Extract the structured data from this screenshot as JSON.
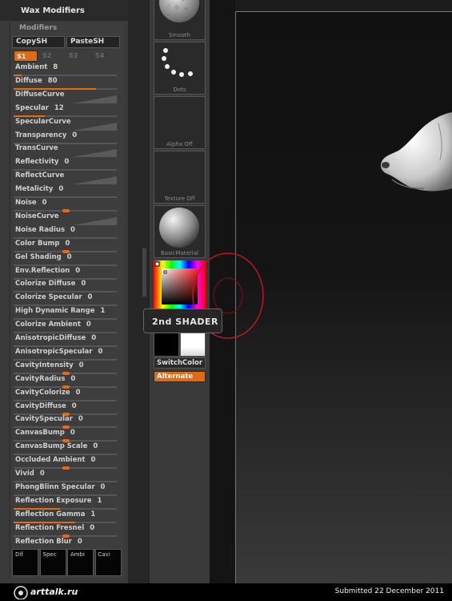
{
  "palette": {
    "title": "Wax Modifiers",
    "section_label": "Modifiers",
    "copy_button": "CopySH",
    "paste_button": "PasteSH",
    "shader_slots": [
      {
        "label": "S1",
        "active": true
      },
      {
        "label": "S2",
        "active": false
      },
      {
        "label": "S3",
        "active": false
      },
      {
        "label": "S4",
        "active": false
      }
    ],
    "sliders": [
      {
        "label": "Ambient",
        "value": "8",
        "level": 0.08
      },
      {
        "label": "Diffuse",
        "value": "80",
        "level": 0.8
      },
      {
        "label": "DiffuseCurve",
        "value": "",
        "curve": true
      },
      {
        "label": "Specular",
        "value": "12",
        "level": 0.3
      },
      {
        "label": "SpecularCurve",
        "value": "",
        "curve": true
      },
      {
        "label": "Transparency",
        "value": "0",
        "level": 0
      },
      {
        "label": "TransCurve",
        "value": "",
        "curve": true
      },
      {
        "label": "Reflectivity",
        "value": "0",
        "level": 0
      },
      {
        "label": "ReflectCurve",
        "value": "",
        "curve": true
      },
      {
        "label": "Metalicity",
        "value": "0",
        "level": 0
      },
      {
        "label": "Noise",
        "value": "0",
        "level": 0.5,
        "center": true
      },
      {
        "label": "NoiseCurve",
        "value": "",
        "curve": true
      },
      {
        "label": "Noise Radius",
        "value": "0",
        "level": 0
      },
      {
        "label": "Color Bump",
        "value": "0",
        "level": 0.5,
        "center": true
      },
      {
        "label": "Gel Shading",
        "value": "0",
        "level": 0
      },
      {
        "label": "Env.Reflection",
        "value": "0",
        "level": 0
      },
      {
        "label": "Colorize Diffuse",
        "value": "0",
        "level": 0
      },
      {
        "label": "Colorize Specular",
        "value": "0",
        "level": 0
      },
      {
        "label": "High Dynamic Range",
        "value": "1",
        "level": 0
      },
      {
        "label": "Colorize Ambient",
        "value": "0",
        "level": 0
      },
      {
        "label": "AnisotropicDiffuse",
        "value": "0",
        "level": 0
      },
      {
        "label": "AnisotropicSpecular",
        "value": "0",
        "level": 0
      },
      {
        "label": "CavityIntensity",
        "value": "0",
        "level": 0.5,
        "center": true
      },
      {
        "label": "CavityRadius",
        "value": "0",
        "level": 0.5,
        "center": true
      },
      {
        "label": "CavityColorize",
        "value": "0",
        "level": 0
      },
      {
        "label": "CavityDiffuse",
        "value": "0",
        "level": 0.5,
        "center": true
      },
      {
        "label": "CavitySpecular",
        "value": "0",
        "level": 0.5,
        "center": true
      },
      {
        "label": "CanvasBump",
        "value": "0",
        "level": 0.5,
        "center": true
      },
      {
        "label": "CanvasBump Scale",
        "value": "0",
        "level": 0
      },
      {
        "label": "Occluded Ambient",
        "value": "0",
        "level": 0.5,
        "center": true
      },
      {
        "label": "Vivid",
        "value": "0",
        "level": 0
      },
      {
        "label": "PhongBlinn Specular",
        "value": "0",
        "level": 0
      },
      {
        "label": "Reflection Exposure",
        "value": "1",
        "level": 0.45
      },
      {
        "label": "Reflection Gamma",
        "value": "1",
        "level": 0.6
      },
      {
        "label": "Reflection Fresnel",
        "value": "0",
        "level": 0.5,
        "center": true
      },
      {
        "label": "Reflection Blur",
        "value": "0",
        "level": 0
      }
    ],
    "mini_tiles": [
      "Dif",
      "Spec",
      "Ambi",
      "Cavi"
    ]
  },
  "tray": {
    "tiles": [
      "Smooth",
      "Dots",
      "Alpha Off",
      "Texture Off",
      "BasicMaterial"
    ],
    "switch_color": "SwitchColor",
    "alternate": "Alternate"
  },
  "tooltip": "2nd SHADER",
  "footer": {
    "logo": "arttalk.ru",
    "submitted": "Submitted 22 December 2011"
  },
  "colors": {
    "accent": "#e46a14",
    "panel": "#3a3a3a",
    "highlight_circle": "#c0141e"
  }
}
